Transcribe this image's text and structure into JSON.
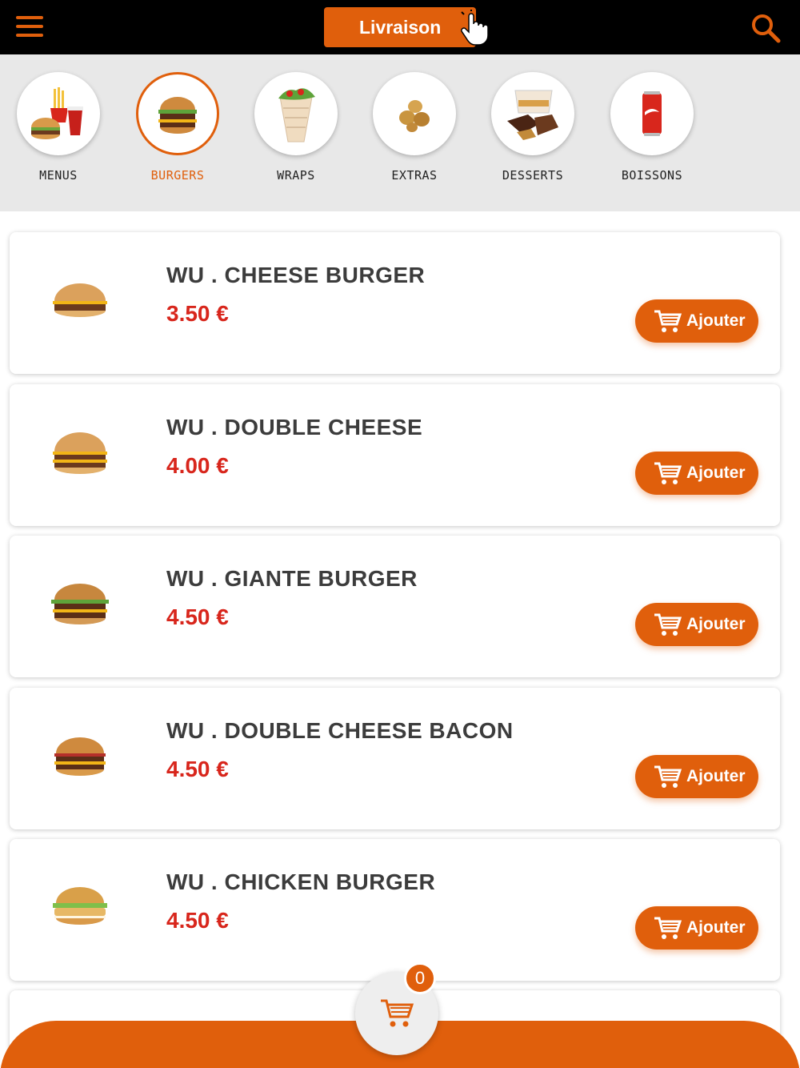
{
  "colors": {
    "accent": "#e05f0c",
    "price": "#d8261c",
    "text": "#3c3c3c"
  },
  "header": {
    "menu_icon": "hamburger-menu-icon",
    "delivery_button_label": "Livraison",
    "hand_icon": "pointer-hand-icon",
    "search_icon": "search-icon"
  },
  "categories": [
    {
      "label": "MENUS",
      "icon": "menu-combo-icon",
      "active": false
    },
    {
      "label": "BURGERS",
      "icon": "burger-icon",
      "active": true
    },
    {
      "label": "WRAPS",
      "icon": "wrap-icon",
      "active": false
    },
    {
      "label": "EXTRAS",
      "icon": "nuggets-icon",
      "active": false
    },
    {
      "label": "DESSERTS",
      "icon": "dessert-icon",
      "active": false
    },
    {
      "label": "BOISSONS",
      "icon": "soda-can-icon",
      "active": false
    }
  ],
  "products": [
    {
      "name": "WU . CHEESE BURGER",
      "price": "3.50 €",
      "add_label": "Ajouter"
    },
    {
      "name": "WU . DOUBLE CHEESE",
      "price": "4.00 €",
      "add_label": "Ajouter"
    },
    {
      "name": "WU . GIANTE BURGER",
      "price": "4.50 €",
      "add_label": "Ajouter"
    },
    {
      "name": "WU . DOUBLE CHEESE BACON",
      "price": "4.50 €",
      "add_label": "Ajouter"
    },
    {
      "name": "WU . CHICKEN BURGER",
      "price": "4.50 €",
      "add_label": "Ajouter"
    }
  ],
  "cart": {
    "count": "0",
    "icon": "shopping-cart-icon"
  }
}
